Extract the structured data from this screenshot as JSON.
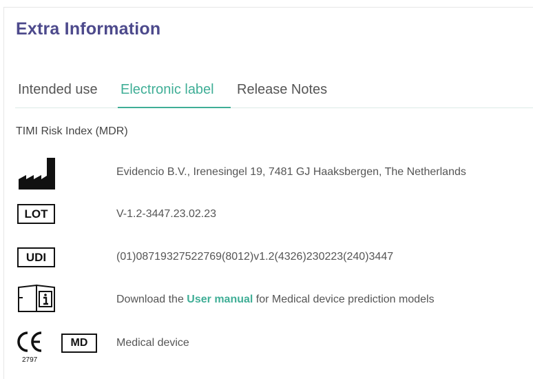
{
  "section": {
    "title": "Extra Information"
  },
  "tabs": [
    {
      "label": "Intended use",
      "active": false
    },
    {
      "label": "Electronic label",
      "active": true
    },
    {
      "label": "Release Notes",
      "active": false
    }
  ],
  "label": {
    "model_name": "TIMI Risk Index (MDR)",
    "manufacturer": {
      "icon": "manufacturer-icon",
      "text": "Evidencio B.V., Irenesingel 19, 7481 GJ Haaksbergen, The Netherlands"
    },
    "lot": {
      "icon_text": "LOT",
      "text": "V-1.2-3447.23.02.23"
    },
    "udi": {
      "icon_text": "UDI",
      "text": "(01)08719327522769(8012)v1.2(4326)230223(240)3447"
    },
    "manual": {
      "icon": "instructions-info-icon",
      "prefix": "Download the ",
      "link": "User manual",
      "suffix": " for Medical device prediction models"
    },
    "device": {
      "ce_mark": "CE",
      "ce_number": "2797",
      "md_text": "MD",
      "text": "Medical device"
    }
  },
  "colors": {
    "title": "#4d4a8c",
    "accent": "#3fae96",
    "text": "#555555"
  }
}
